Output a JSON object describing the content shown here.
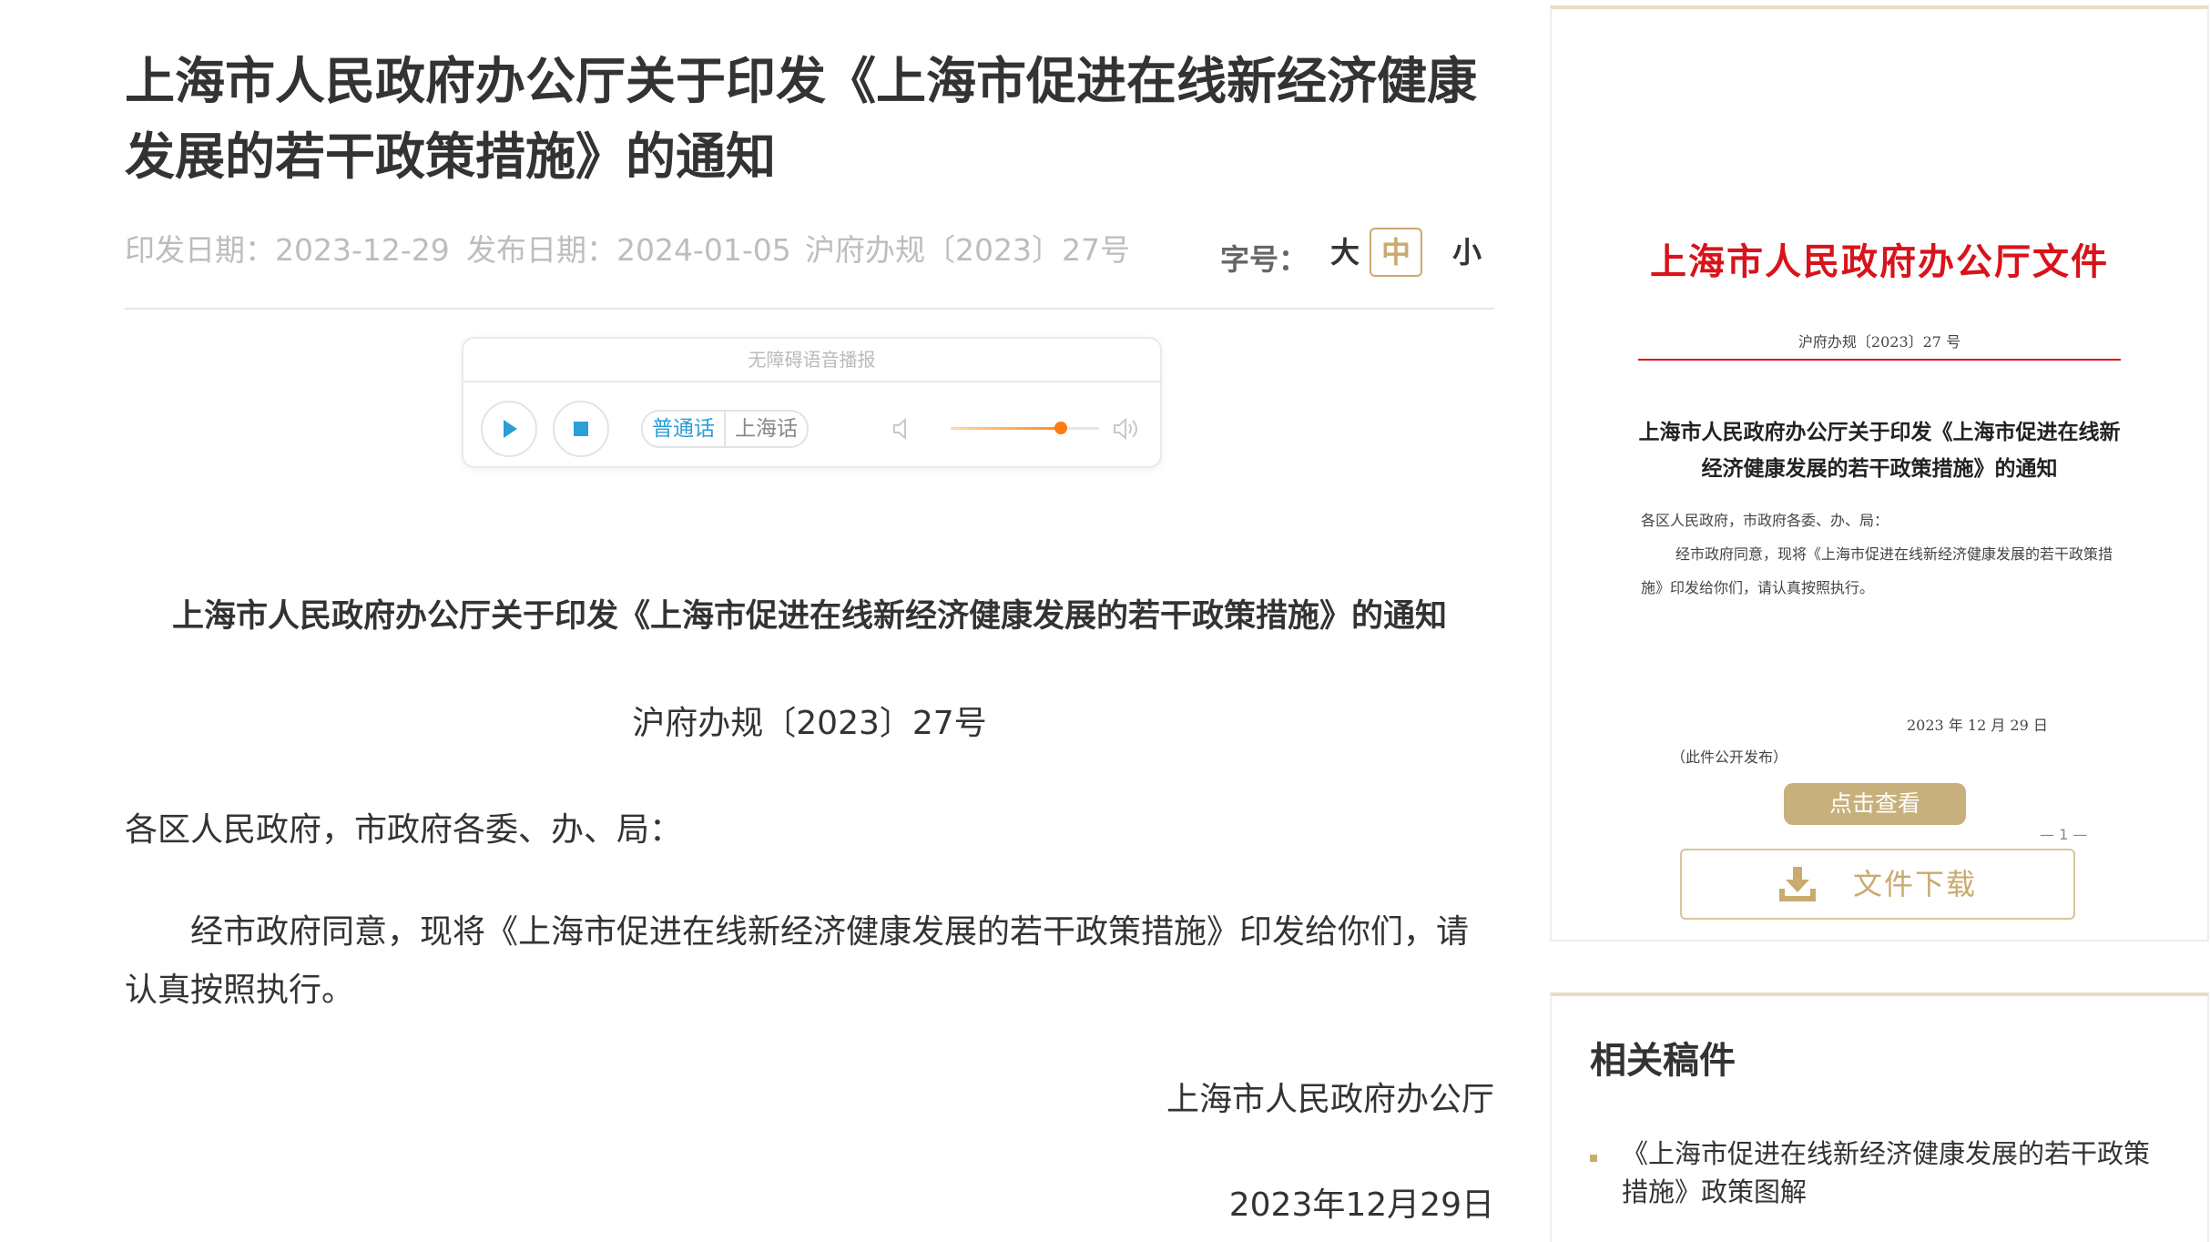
{
  "article": {
    "title": "上海市人民政府办公厅关于印发《上海市促进在线新经济健康发展的若干政策措施》的通知",
    "meta": {
      "issue_date": "印发日期：2023-12-29",
      "publish_date": "发布日期：2024-01-05",
      "doc_number": "沪府办规〔2023〕27号"
    },
    "font_size": {
      "label": "字号：",
      "options": [
        "大",
        "中",
        "小"
      ],
      "selected": "中"
    },
    "player": {
      "header": "无障碍语音播报",
      "languages": [
        "普通话",
        "上海话"
      ],
      "selected_language": "普通话",
      "volume": 0.74
    },
    "doc_title": "上海市人民政府办公厅关于印发《上海市促进在线新经济健康发展的若干政策措施》的通知",
    "doc_no": "沪府办规〔2023〕27号",
    "salutation": "各区人民政府，市政府各委、办、局：",
    "body": "经市政府同意，现将《上海市促进在线新经济健康发展的若干政策措施》印发给你们，请认真按照执行。",
    "signature": "上海市人民政府办公厅",
    "date": "2023年12月29日"
  },
  "sidebar": {
    "preview": {
      "header": "上海市人民政府办公厅文件",
      "doc_no": "沪府办规〔2023〕27 号",
      "title": "上海市人民政府办公厅关于印发《上海市促进在线新经济健康发展的若干政策措施》的通知",
      "salutation": "各区人民政府，市政府各委、办、局：",
      "body": "经市政府同意，现将《上海市促进在线新经济健康发展的若干政策措施》印发给你们，请认真按照执行。",
      "date": "2023 年 12 月 29 日",
      "public_note": "（此件公开发布）",
      "page_number": "— 1 —",
      "view_button": "点击查看"
    },
    "download_label": "文件下载",
    "related": {
      "title": "相关稿件",
      "items": [
        "《上海市促进在线新经济健康发展的若干政策措施》政策图解"
      ]
    }
  },
  "colors": {
    "accent_gold": "#c9aa6f",
    "red_header": "#d8131b",
    "player_blue": "#2a9fd8",
    "volume_orange": "#ff7a12"
  }
}
